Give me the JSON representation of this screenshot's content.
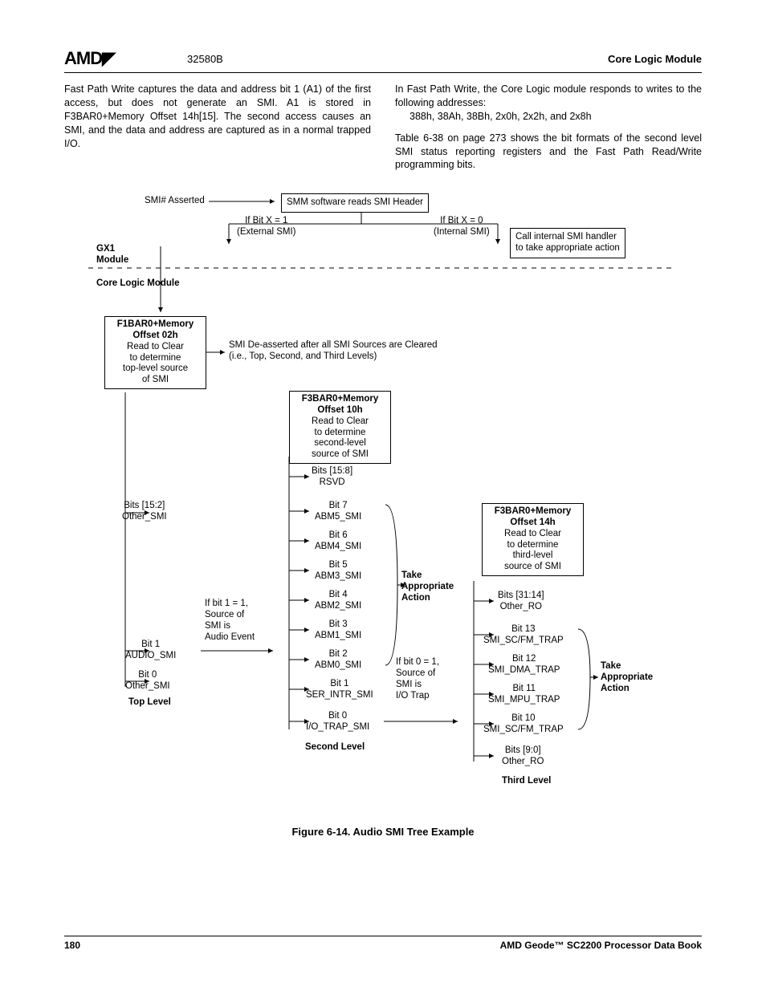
{
  "header": {
    "logo": "AMD",
    "docnum": "32580B",
    "module": "Core Logic Module"
  },
  "para1": "Fast Path Write captures the data and address bit 1 (A1) of the first access, but does not generate an SMI. A1 is stored in F3BAR0+Memory Offset 14h[15]. The second access causes an SMI, and the data and address are captured as in a normal trapped I/O.",
  "para2a": "In Fast Path Write, the Core Logic module responds to writes to the following addresses:",
  "para2b": "388h, 38Ah, 38Bh, 2x0h, 2x2h, and 2x8h",
  "para3": "Table 6-38 on page 273 shows the bit formats of the second level SMI status reporting registers and the Fast Path Read/Write programming bits.",
  "diagram": {
    "smi_asserted": "SMI# Asserted",
    "smm_reads": "SMM software reads SMI Header",
    "bitx1a": "If Bit X = 1",
    "bitx1b": "(External SMI)",
    "bitx0a": "If Bit X = 0",
    "bitx0b": "(Internal SMI)",
    "callhandler1": "Call internal SMI handler",
    "callhandler2": "to take appropriate action",
    "gx1a": "GX1",
    "gx1b": "Module",
    "clm": "Core Logic Module",
    "f1bar_t": "F1BAR0+Memory",
    "f1bar_o": "Offset 02h",
    "f1bar_1": "Read to Clear",
    "f1bar_2": "to determine",
    "f1bar_3": "top-level source",
    "f1bar_4": "of SMI",
    "deassert1": "SMI De-asserted after all SMI Sources are Cleared",
    "deassert2": "(i.e., Top, Second, and Third Levels)",
    "f3bar10_t": "F3BAR0+Memory",
    "f3bar10_o": "Offset 10h",
    "f3bar10_1": "Read to Clear",
    "f3bar10_2": "to determine",
    "f3bar10_3": "second-level",
    "f3bar10_4": "source of SMI",
    "b158a": "Bits [15:8]",
    "b158b": "RSVD",
    "b7a": "Bit 7",
    "b7b": "ABM5_SMI",
    "b6a": "Bit 6",
    "b6b": "ABM4_SMI",
    "b5a": "Bit 5",
    "b5b": "ABM3_SMI",
    "b4a": "Bit 4",
    "b4b": "ABM2_SMI",
    "b3a": "Bit 3",
    "b3b": "ABM1_SMI",
    "b2a": "Bit 2",
    "b2b": "ABM0_SMI",
    "b1sa": "Bit 1",
    "b1sb": "SER_INTR_SMI",
    "b0sa": "Bit 0",
    "b0sb": "I/O_TRAP_SMI",
    "bits152a": "Bits [15:2]",
    "bits152b": "Other_SMI",
    "t_bit1a": "Bit 1",
    "t_bit1b": "AUDIO_SMI",
    "t_bit0a": "Bit 0",
    "t_bit0b": "Other_SMI",
    "top_level": "Top Level",
    "second_level": "Second Level",
    "ifbit1a": "If bit 1 = 1,",
    "ifbit1b": "Source of",
    "ifbit1c": "SMI is",
    "ifbit1d": "Audio Event",
    "take1": "Take",
    "take2": "Appropriate",
    "take3": "Action",
    "ifbit0a": "If bit 0 = 1,",
    "ifbit0b": "Source of",
    "ifbit0c": "SMI is",
    "ifbit0d": "I/O Trap",
    "f3bar14_t": "F3BAR0+Memory",
    "f3bar14_o": "Offset 14h",
    "f3bar14_1": "Read to Clear",
    "f3bar14_2": "to determine",
    "f3bar14_3": "third-level",
    "f3bar14_4": "source of SMI",
    "t31a": "Bits [31:14]",
    "t31b": "Other_RO",
    "t13a": "Bit 13",
    "t13b": "SMI_SC/FM_TRAP",
    "t12a": "Bit 12",
    "t12b": "SMI_DMA_TRAP",
    "t11a": "Bit 11",
    "t11b": "SMI_MPU_TRAP",
    "t10a": "Bit 10",
    "t10b": "SMI_SC/FM_TRAP",
    "t90a": "Bits [9:0]",
    "t90b": "Other_RO",
    "third_level": "Third Level",
    "take_r1": "Take",
    "take_r2": "Appropriate",
    "take_r3": "Action"
  },
  "caption": "Figure 6-14.  Audio SMI Tree Example",
  "footer": {
    "page": "180",
    "book": "AMD Geode™ SC2200  Processor Data Book"
  }
}
